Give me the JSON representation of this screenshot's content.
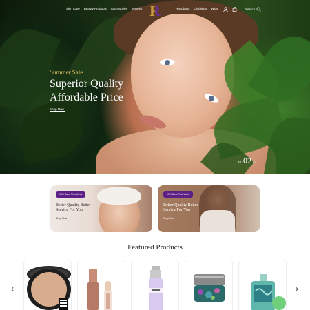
{
  "nav": {
    "left_links": [
      "Skin Care",
      "Beauty Products",
      "Accessories",
      "Jewelry"
    ],
    "right_links": [
      "Handbags",
      "Clothings",
      "Wigs"
    ],
    "search_label": "Search",
    "logo_text": "R",
    "icons": [
      "user-icon",
      "bag-icon",
      "search-icon"
    ]
  },
  "hero": {
    "tagline": "Summer Sale",
    "headline_line1": "Superior Quality",
    "headline_line2": "Affordable Price",
    "shop_link": "Shop Now",
    "slide_prefix": "01",
    "slide_current": "02",
    "slide_total": "03"
  },
  "promos": [
    {
      "badge": "15% Save This Week",
      "title_line1": "Better Quality Better",
      "title_line2": "Service For You",
      "link": "Shop Now"
    },
    {
      "badge": "15% Save This Week",
      "title_line1": "Better Quality Better",
      "title_line2": "Service For You",
      "link": "Shop Now"
    }
  ],
  "featured": {
    "title": "Featured Products",
    "prev_arrow": "‹",
    "next_arrow": "›",
    "products": [
      "compact-powder",
      "lip-oil",
      "spray-bottle",
      "eye-cream-jar",
      "perfume-bottle"
    ]
  },
  "colors": {
    "accent_purple": "#5b1f86",
    "gold": "#e4c36a",
    "sale_badge_green": "#6fcf7a"
  }
}
